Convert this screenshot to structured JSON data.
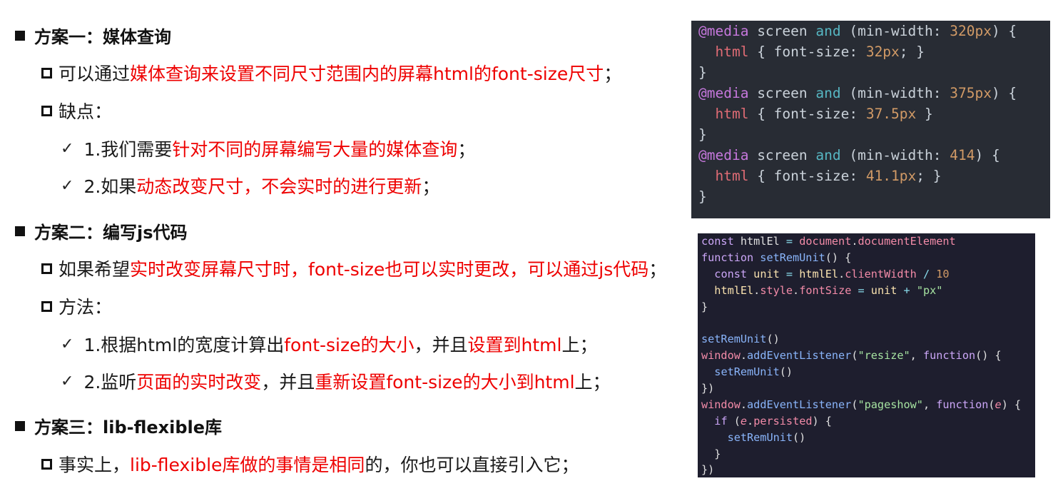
{
  "sections": [
    {
      "heading": "方案一：媒体查询",
      "items": [
        {
          "type": "bullet",
          "segments": [
            {
              "t": "可以通过",
              "red": false
            },
            {
              "t": "媒体查询来设置不同尺寸范围内的屏幕html的font-size尺寸",
              "red": true
            },
            {
              "t": "；",
              "red": false
            }
          ]
        },
        {
          "type": "bullet",
          "segments": [
            {
              "t": "缺点：",
              "red": false
            }
          ]
        },
        {
          "type": "check",
          "segments": [
            {
              "t": "1.我们需要",
              "red": false
            },
            {
              "t": "针对不同的屏幕编写大量的媒体查询",
              "red": true
            },
            {
              "t": "；",
              "red": false
            }
          ]
        },
        {
          "type": "check",
          "segments": [
            {
              "t": "2.如果",
              "red": false
            },
            {
              "t": "动态改变尺寸，不会实时的进行更新",
              "red": true
            },
            {
              "t": "；",
              "red": false
            }
          ]
        }
      ]
    },
    {
      "heading": "方案二：编写js代码",
      "items": [
        {
          "type": "bullet",
          "segments": [
            {
              "t": "如果希望",
              "red": false
            },
            {
              "t": "实时改变屏幕尺寸时，font-size也可以实时更改，可以通过js代码",
              "red": true
            },
            {
              "t": "；",
              "red": false
            }
          ]
        },
        {
          "type": "bullet",
          "segments": [
            {
              "t": "方法：",
              "red": false
            }
          ]
        },
        {
          "type": "check",
          "segments": [
            {
              "t": "1.根据html的宽度计算出",
              "red": false
            },
            {
              "t": "font-size的大小",
              "red": true
            },
            {
              "t": "，并且",
              "red": false
            },
            {
              "t": "设置到html",
              "red": true
            },
            {
              "t": "上；",
              "red": false
            }
          ]
        },
        {
          "type": "check",
          "segments": [
            {
              "t": "2.监听",
              "red": false
            },
            {
              "t": "页面的实时改变",
              "red": true
            },
            {
              "t": "，并且",
              "red": false
            },
            {
              "t": "重新设置font-size的大小到html",
              "red": true
            },
            {
              "t": "上；",
              "red": false
            }
          ]
        }
      ]
    },
    {
      "heading": "方案三：lib-flexible库",
      "items": [
        {
          "type": "bullet",
          "segments": [
            {
              "t": "事实上，",
              "red": false
            },
            {
              "t": "lib-flexible库做的事情是相同",
              "red": true
            },
            {
              "t": "的，你也可以直接引入它；",
              "red": false
            }
          ]
        }
      ]
    }
  ],
  "code_block_1": [
    [
      {
        "t": "@media",
        "c": "at"
      },
      {
        "t": " screen ",
        "c": "pl"
      },
      {
        "t": "and",
        "c": "kw"
      },
      {
        "t": " (min-width: ",
        "c": "pl"
      },
      {
        "t": "320px",
        "c": "num"
      },
      {
        "t": ") {",
        "c": "pl"
      }
    ],
    [
      {
        "t": "  ",
        "c": "pl"
      },
      {
        "t": "html",
        "c": "tag"
      },
      {
        "t": " { font-size: ",
        "c": "pl"
      },
      {
        "t": "32px",
        "c": "num"
      },
      {
        "t": "; }",
        "c": "pl"
      }
    ],
    [
      {
        "t": "}",
        "c": "pl"
      }
    ],
    [
      {
        "t": "@media",
        "c": "at"
      },
      {
        "t": " screen ",
        "c": "pl"
      },
      {
        "t": "and",
        "c": "kw"
      },
      {
        "t": " (min-width: ",
        "c": "pl"
      },
      {
        "t": "375px",
        "c": "num"
      },
      {
        "t": ") {",
        "c": "pl"
      }
    ],
    [
      {
        "t": "  ",
        "c": "pl"
      },
      {
        "t": "html",
        "c": "tag"
      },
      {
        "t": " { font-size: ",
        "c": "pl"
      },
      {
        "t": "37.5px",
        "c": "num"
      },
      {
        "t": " }",
        "c": "pl"
      }
    ],
    [
      {
        "t": "}",
        "c": "pl"
      }
    ],
    [
      {
        "t": "@media",
        "c": "at"
      },
      {
        "t": " screen ",
        "c": "pl"
      },
      {
        "t": "and",
        "c": "kw"
      },
      {
        "t": " (min-width: ",
        "c": "pl"
      },
      {
        "t": "414",
        "c": "num"
      },
      {
        "t": ") {",
        "c": "pl"
      }
    ],
    [
      {
        "t": "  ",
        "c": "pl"
      },
      {
        "t": "html",
        "c": "tag"
      },
      {
        "t": " { font-size: ",
        "c": "pl"
      },
      {
        "t": "41.1px",
        "c": "num"
      },
      {
        "t": "; }",
        "c": "pl"
      }
    ],
    [
      {
        "t": "}",
        "c": "pl"
      }
    ]
  ],
  "code_block_2": [
    [
      {
        "t": "const ",
        "c": "kw2"
      },
      {
        "t": "htmlEl",
        "c": "sub"
      },
      {
        "t": " = ",
        "c": "op"
      },
      {
        "t": "document",
        "c": "red2"
      },
      {
        "t": ".",
        "c": "sub"
      },
      {
        "t": "documentElement",
        "c": "red2"
      }
    ],
    [
      {
        "t": "function ",
        "c": "kw2"
      },
      {
        "t": "setRemUnit",
        "c": "fn"
      },
      {
        "t": "() {",
        "c": "sub"
      }
    ],
    [
      {
        "t": "  ",
        "c": "sub"
      },
      {
        "t": "const ",
        "c": "kw2"
      },
      {
        "t": "unit",
        "c": "prop"
      },
      {
        "t": " = ",
        "c": "op"
      },
      {
        "t": "htmlEl",
        "c": "prop"
      },
      {
        "t": ".",
        "c": "sub"
      },
      {
        "t": "clientWidth",
        "c": "red2"
      },
      {
        "t": " / ",
        "c": "op"
      },
      {
        "t": "10",
        "c": "num"
      }
    ],
    [
      {
        "t": "  ",
        "c": "sub"
      },
      {
        "t": "htmlEl",
        "c": "prop"
      },
      {
        "t": ".",
        "c": "sub"
      },
      {
        "t": "style",
        "c": "red2"
      },
      {
        "t": ".",
        "c": "sub"
      },
      {
        "t": "fontSize",
        "c": "red2"
      },
      {
        "t": " = ",
        "c": "op"
      },
      {
        "t": "unit",
        "c": "prop"
      },
      {
        "t": " + ",
        "c": "op"
      },
      {
        "t": "\"px\"",
        "c": "str"
      }
    ],
    [
      {
        "t": "}",
        "c": "sub"
      }
    ],
    [
      {
        "t": "",
        "c": "sub"
      }
    ],
    [
      {
        "t": "setRemUnit",
        "c": "fn"
      },
      {
        "t": "()",
        "c": "sub"
      }
    ],
    [
      {
        "t": "window",
        "c": "red2"
      },
      {
        "t": ".",
        "c": "sub"
      },
      {
        "t": "addEventListener",
        "c": "fn"
      },
      {
        "t": "(",
        "c": "sub"
      },
      {
        "t": "\"resize\"",
        "c": "str"
      },
      {
        "t": ", ",
        "c": "sub"
      },
      {
        "t": "function",
        "c": "kw2"
      },
      {
        "t": "() {",
        "c": "sub"
      }
    ],
    [
      {
        "t": "  ",
        "c": "sub"
      },
      {
        "t": "setRemUnit",
        "c": "fn"
      },
      {
        "t": "()",
        "c": "sub"
      }
    ],
    [
      {
        "t": "})",
        "c": "sub"
      }
    ],
    [
      {
        "t": "window",
        "c": "red2"
      },
      {
        "t": ".",
        "c": "sub"
      },
      {
        "t": "addEventListener",
        "c": "fn"
      },
      {
        "t": "(",
        "c": "sub"
      },
      {
        "t": "\"pageshow\"",
        "c": "str"
      },
      {
        "t": ", ",
        "c": "sub"
      },
      {
        "t": "function",
        "c": "kw2"
      },
      {
        "t": "(",
        "c": "sub"
      },
      {
        "t": "e",
        "c": "ital"
      },
      {
        "t": ") {",
        "c": "sub"
      }
    ],
    [
      {
        "t": "  ",
        "c": "sub"
      },
      {
        "t": "if ",
        "c": "kw2"
      },
      {
        "t": "(",
        "c": "sub"
      },
      {
        "t": "e",
        "c": "ital"
      },
      {
        "t": ".",
        "c": "sub"
      },
      {
        "t": "persisted",
        "c": "red2"
      },
      {
        "t": ") {",
        "c": "sub"
      }
    ],
    [
      {
        "t": "    ",
        "c": "sub"
      },
      {
        "t": "setRemUnit",
        "c": "fn"
      },
      {
        "t": "()",
        "c": "sub"
      }
    ],
    [
      {
        "t": "  }",
        "c": "sub"
      }
    ],
    [
      {
        "t": "})",
        "c": "sub"
      }
    ]
  ]
}
